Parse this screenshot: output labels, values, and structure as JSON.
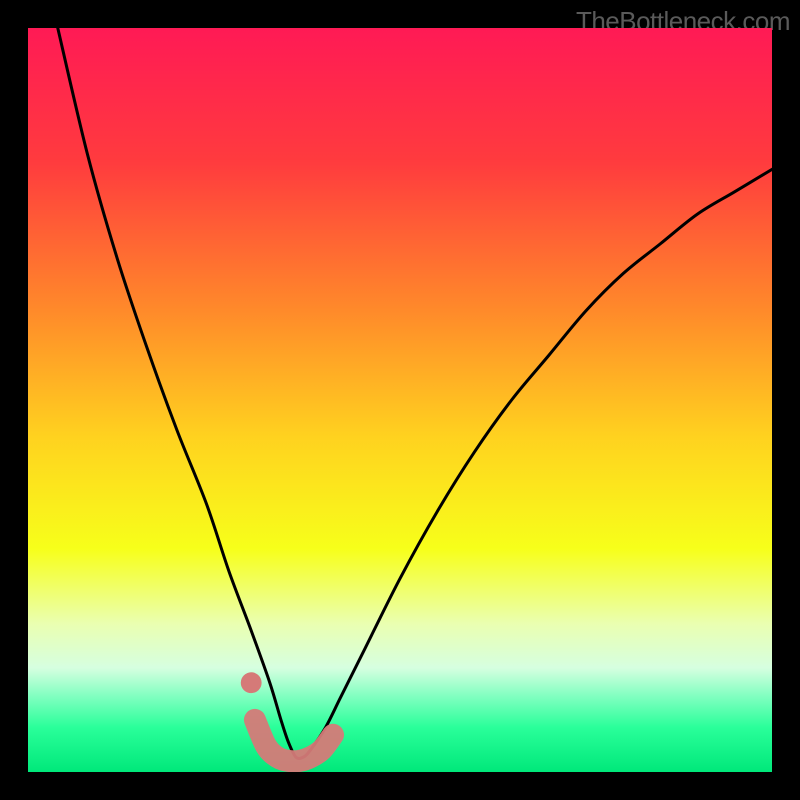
{
  "watermark": "TheBottleneck.com",
  "chart_data": {
    "type": "line",
    "title": "",
    "xlabel": "",
    "ylabel": "",
    "xlim": [
      0,
      100
    ],
    "ylim": [
      0,
      100
    ],
    "background_gradient": {
      "stops": [
        {
          "offset": 0,
          "color": "#ff1a55"
        },
        {
          "offset": 18,
          "color": "#ff3b3e"
        },
        {
          "offset": 38,
          "color": "#ff8a2a"
        },
        {
          "offset": 55,
          "color": "#ffd21f"
        },
        {
          "offset": 70,
          "color": "#f7ff1a"
        },
        {
          "offset": 80,
          "color": "#eaffb0"
        },
        {
          "offset": 86,
          "color": "#d6ffe0"
        },
        {
          "offset": 90,
          "color": "#7dffbf"
        },
        {
          "offset": 94,
          "color": "#2aff9a"
        },
        {
          "offset": 100,
          "color": "#00e87a"
        }
      ]
    },
    "series": [
      {
        "name": "bottleneck-curve",
        "color": "#000000",
        "x": [
          4,
          8,
          12,
          16,
          20,
          24,
          27,
          30,
          32.5,
          34,
          35,
          36,
          37,
          38,
          40,
          42,
          45,
          50,
          55,
          60,
          65,
          70,
          75,
          80,
          85,
          90,
          95,
          100
        ],
        "y": [
          100,
          83,
          69,
          57,
          46,
          36,
          27,
          19,
          12,
          7,
          4,
          2,
          2,
          3,
          6,
          10,
          16,
          26,
          35,
          43,
          50,
          56,
          62,
          67,
          71,
          75,
          78,
          81
        ]
      },
      {
        "name": "optimal-marker",
        "color": "#d57a78",
        "type": "thick-segment",
        "x": [
          30.5,
          32,
          33.5,
          35,
          36.5,
          38,
          39.5,
          41
        ],
        "y": [
          7,
          3.5,
          2,
          1.5,
          1.5,
          2,
          3,
          5
        ]
      }
    ],
    "markers": [
      {
        "name": "dot-left",
        "x": 30,
        "y": 12,
        "color": "#d57a78",
        "r": 1.4
      }
    ]
  }
}
